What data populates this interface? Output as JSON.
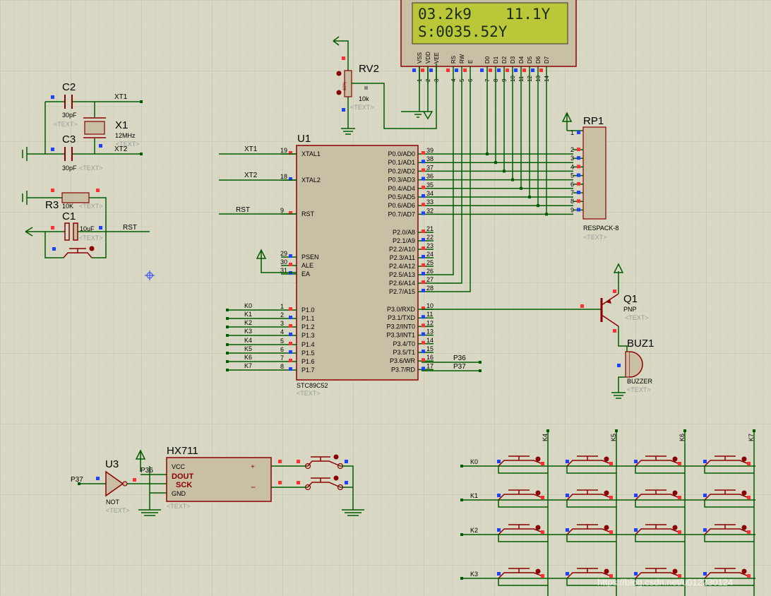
{
  "lcd": {
    "line1_left": "03.2k9",
    "line1_right": "11.1Y",
    "line2": "S:0035.52Y",
    "pins": [
      "VSS",
      "VDD",
      "VEE",
      "RS",
      "RW",
      "E",
      "D0",
      "D1",
      "D2",
      "D3",
      "D4",
      "D5",
      "D6",
      "D7"
    ],
    "pin_numbers": [
      "1",
      "2",
      "3",
      "4",
      "5",
      "6",
      "7",
      "8",
      "9",
      "10",
      "11",
      "12",
      "13",
      "14"
    ]
  },
  "rv2": {
    "ref": "RV2",
    "value": "10k",
    "text": "<TEXT>",
    "pct": "60%"
  },
  "c2": {
    "ref": "C2",
    "value": "30pF",
    "text": "<TEXT>"
  },
  "c3": {
    "ref": "C3",
    "value": "30pF",
    "text": "<TEXT>"
  },
  "x1": {
    "ref": "X1",
    "value": "12MHz",
    "text": "<TEXT>"
  },
  "r3": {
    "ref": "R3",
    "value": "10K",
    "text": "<TEXT>"
  },
  "c1": {
    "ref": "C1",
    "value": "10uF",
    "text": "<TEXT>"
  },
  "nets": {
    "xt1": "XT1",
    "xt2": "XT2",
    "rst": "RST",
    "p36": "P36",
    "p37": "P37"
  },
  "u1": {
    "ref": "U1",
    "part": "STC89C52",
    "text": "<TEXT>",
    "left_pins": [
      {
        "num": "19",
        "name": "XTAL1",
        "net": "XT1"
      },
      {
        "num": "18",
        "name": "XTAL2",
        "net": "XT2"
      },
      {
        "num": "9",
        "name": "RST",
        "net": "RST"
      },
      {
        "num": "29",
        "name": "PSEN",
        "net": ""
      },
      {
        "num": "30",
        "name": "ALE",
        "net": ""
      },
      {
        "num": "31",
        "name": "EA",
        "net": ""
      },
      {
        "num": "1",
        "name": "P1.0",
        "net": "K0"
      },
      {
        "num": "2",
        "name": "P1.1",
        "net": "K1"
      },
      {
        "num": "3",
        "name": "P1.2",
        "net": "K2"
      },
      {
        "num": "4",
        "name": "P1.3",
        "net": "K3"
      },
      {
        "num": "5",
        "name": "P1.4",
        "net": "K4"
      },
      {
        "num": "6",
        "name": "P1.5",
        "net": "K5"
      },
      {
        "num": "7",
        "name": "P1.6",
        "net": "K6"
      },
      {
        "num": "8",
        "name": "P1.7",
        "net": "K7"
      }
    ],
    "right_pins": [
      {
        "num": "39",
        "name": "P0.0/AD0"
      },
      {
        "num": "38",
        "name": "P0.1/AD1"
      },
      {
        "num": "37",
        "name": "P0.2/AD2"
      },
      {
        "num": "36",
        "name": "P0.3/AD3"
      },
      {
        "num": "35",
        "name": "P0.4/AD4"
      },
      {
        "num": "34",
        "name": "P0.5/AD5"
      },
      {
        "num": "33",
        "name": "P0.6/AD6"
      },
      {
        "num": "32",
        "name": "P0.7/AD7"
      },
      {
        "num": "21",
        "name": "P2.0/A8"
      },
      {
        "num": "22",
        "name": "P2.1/A9"
      },
      {
        "num": "23",
        "name": "P2.2/A10"
      },
      {
        "num": "24",
        "name": "P2.3/A11"
      },
      {
        "num": "25",
        "name": "P2.4/A12"
      },
      {
        "num": "26",
        "name": "P2.5/A13"
      },
      {
        "num": "27",
        "name": "P2.6/A14"
      },
      {
        "num": "28",
        "name": "P2.7/A15"
      },
      {
        "num": "10",
        "name": "P3.0/RXD"
      },
      {
        "num": "11",
        "name": "P3.1/TXD"
      },
      {
        "num": "12",
        "name": "P3.2/INT0"
      },
      {
        "num": "13",
        "name": "P3.3/INT1"
      },
      {
        "num": "14",
        "name": "P3.4/T0"
      },
      {
        "num": "15",
        "name": "P3.5/T1"
      },
      {
        "num": "16",
        "name": "P3.6/WR"
      },
      {
        "num": "17",
        "name": "P3.7/RD"
      }
    ]
  },
  "rp1": {
    "ref": "RP1",
    "part": "RESPACK-8",
    "text": "<TEXT>",
    "pins": [
      "1",
      "2",
      "3",
      "4",
      "5",
      "6",
      "7",
      "8",
      "9"
    ]
  },
  "q1": {
    "ref": "Q1",
    "type": "PNP",
    "text": "<TEXT>"
  },
  "buz1": {
    "ref": "BUZ1",
    "type": "BUZZER",
    "text": "<TEXT>"
  },
  "u3": {
    "ref": "U3",
    "type": "NOT",
    "text": "<TEXT>"
  },
  "hx711": {
    "ref": "HX711",
    "vcc": "VCC",
    "dout": "DOUT",
    "sck": "SCK",
    "gnd": "GND",
    "plus": "+",
    "minus": "−",
    "text": "<TEXT>"
  },
  "keypad": {
    "rows": [
      "K0",
      "K1",
      "K2",
      "K3"
    ],
    "cols": [
      "K4",
      "K5",
      "K6",
      "K7"
    ]
  },
  "watermark": "https://blog.csdn.net/u012230124",
  "colors": {
    "background": "#d9d8c4",
    "grid": "#c8c7b1",
    "wire": "#005c00",
    "component": "#8b0000",
    "body_fill": "#c9bfa5",
    "lcd_fill": "#b9c738",
    "pin_red": "#ff3030",
    "pin_blue": "#2040ff"
  }
}
